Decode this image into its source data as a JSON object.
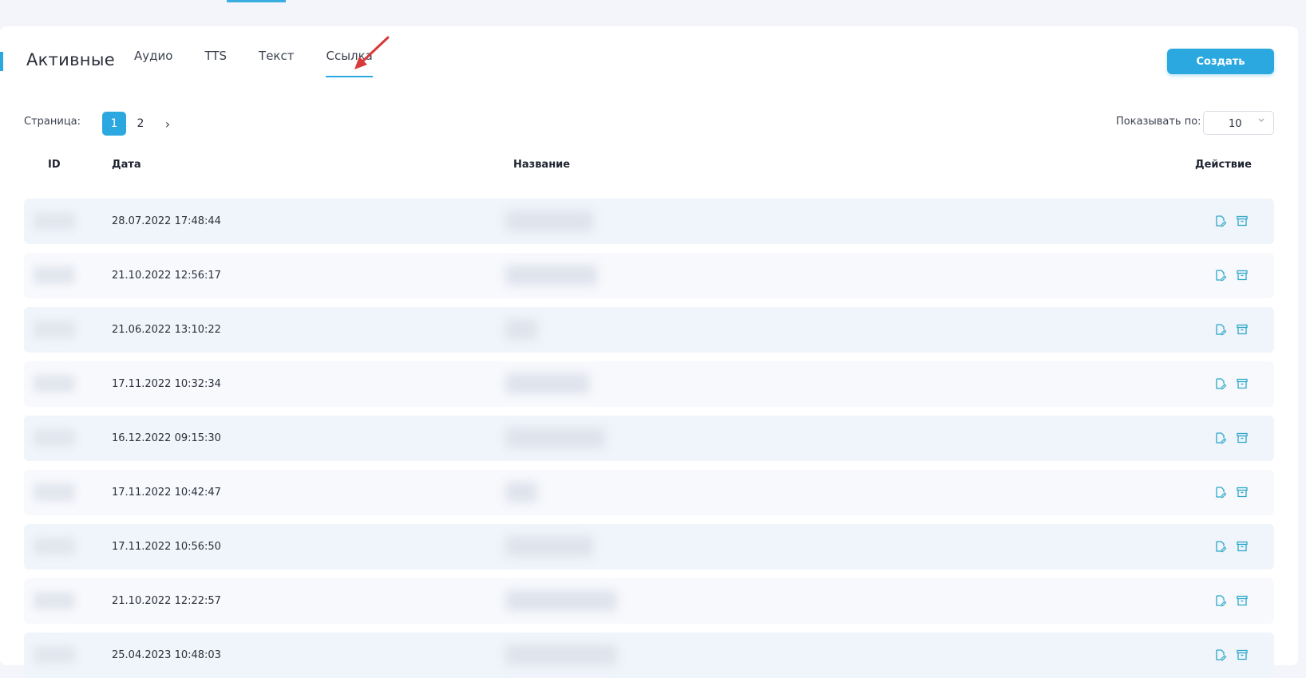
{
  "header": {
    "title": "Активные",
    "tabs": [
      {
        "label": "Аудио",
        "active": false
      },
      {
        "label": "TTS",
        "active": false
      },
      {
        "label": "Текст",
        "active": false
      },
      {
        "label": "Ссылка",
        "active": true
      }
    ],
    "create_label": "Создать"
  },
  "pager": {
    "label": "Страница:",
    "pages": [
      "1",
      "2"
    ],
    "current": "1",
    "next_glyph": "›",
    "show_label": "Показывать по:",
    "per_page": "10"
  },
  "table": {
    "columns": {
      "id": "ID",
      "date": "Дата",
      "name": "Название",
      "action": "Действие"
    },
    "rows": [
      {
        "date": "28.07.2022 17:48:44"
      },
      {
        "date": "21.10.2022 12:56:17"
      },
      {
        "date": "21.06.2022 13:10:22"
      },
      {
        "date": "17.11.2022 10:32:34"
      },
      {
        "date": "16.12.2022 09:15:30"
      },
      {
        "date": "17.11.2022 10:42:47"
      },
      {
        "date": "17.11.2022 10:56:50"
      },
      {
        "date": "21.10.2022 12:22:57"
      },
      {
        "date": "25.04.2023 10:48:03"
      }
    ]
  },
  "colors": {
    "accent": "#2ba8e0",
    "arrow": "#d63a3a",
    "icon": "#2ba8c8"
  },
  "icons": {
    "edit": "edit-icon",
    "archive": "archive-icon",
    "dropdown": "chevron-down-icon"
  }
}
